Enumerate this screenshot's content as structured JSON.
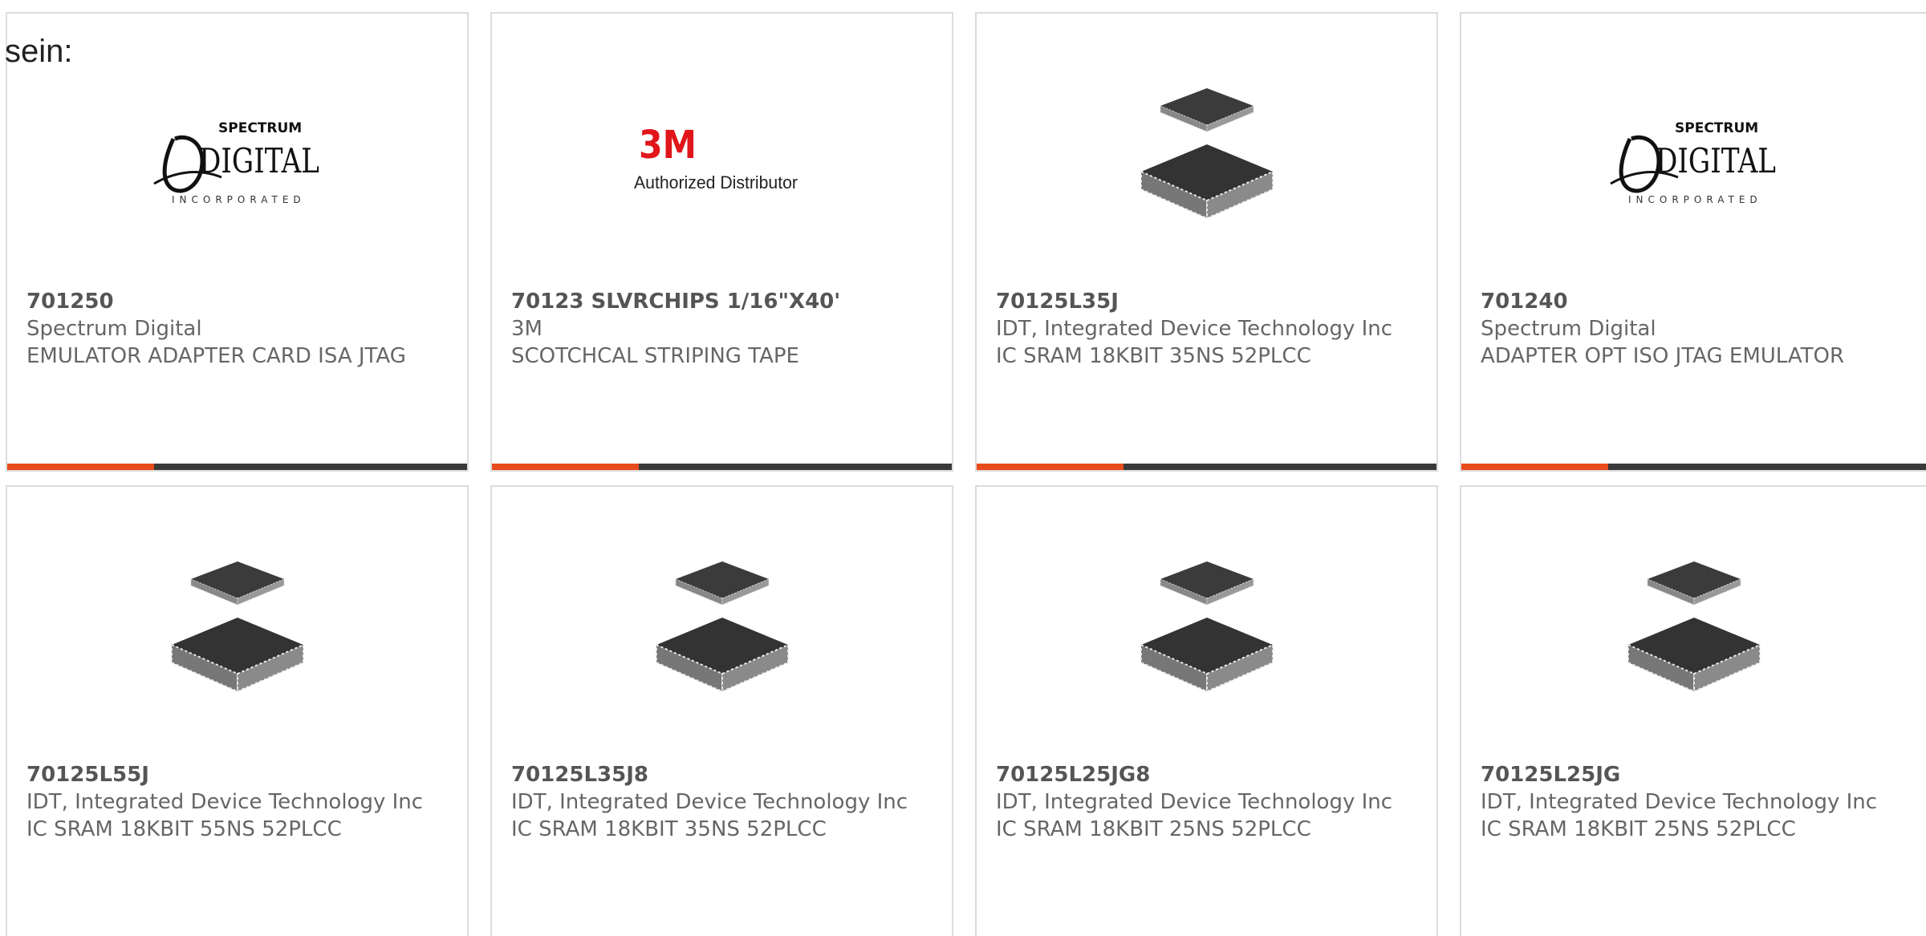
{
  "intro_text": "sein:",
  "products": [
    {
      "part_number": "701250",
      "manufacturer": "Spectrum Digital",
      "description": "EMULATOR ADAPTER CARD ISA JTAG",
      "image": "spectrum-digital-logo",
      "logo": {
        "small": "SPECTRUM",
        "big": "DIGITAL",
        "sub": "INCORPORATED"
      }
    },
    {
      "part_number": "70123 SLVRCHIPS 1/16\"X40'",
      "manufacturer": "3M",
      "description": "SCOTCHCAL STRIPING TAPE",
      "image": "3m-authorized-distributor-logo",
      "logo": {
        "brand": "3M",
        "sub": "Authorized Distributor"
      }
    },
    {
      "part_number": "70125L35J",
      "manufacturer": "IDT, Integrated Device Technology Inc",
      "description": "IC SRAM 18KBIT 35NS 52PLCC",
      "image": "plcc-chip"
    },
    {
      "part_number": "701240",
      "manufacturer": "Spectrum Digital",
      "description": "ADAPTER OPT ISO JTAG EMULATOR",
      "image": "spectrum-digital-logo",
      "logo": {
        "small": "SPECTRUM",
        "big": "DIGITAL",
        "sub": "INCORPORATED"
      }
    },
    {
      "part_number": "70125L55J",
      "manufacturer": "IDT, Integrated Device Technology Inc",
      "description": "IC SRAM 18KBIT 55NS 52PLCC",
      "image": "plcc-chip"
    },
    {
      "part_number": "70125L35J8",
      "manufacturer": "IDT, Integrated Device Technology Inc",
      "description": "IC SRAM 18KBIT 35NS 52PLCC",
      "image": "plcc-chip"
    },
    {
      "part_number": "70125L25JG8",
      "manufacturer": "IDT, Integrated Device Technology Inc",
      "description": "IC SRAM 18KBIT 25NS 52PLCC",
      "image": "plcc-chip"
    },
    {
      "part_number": "70125L25JG",
      "manufacturer": "IDT, Integrated Device Technology Inc",
      "description": "IC SRAM 18KBIT 25NS 52PLCC",
      "image": "plcc-chip"
    }
  ],
  "colors": {
    "accent": "#e84c1d",
    "bar_dark": "#3a3a3a",
    "card_border": "#dcdcdc",
    "text": "#666666"
  }
}
